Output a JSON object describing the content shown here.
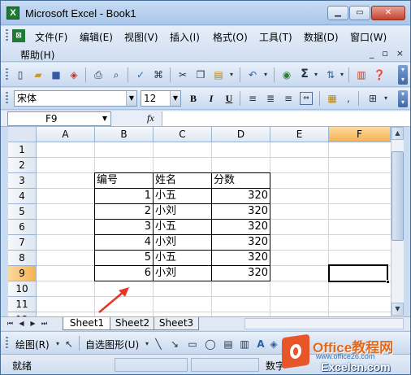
{
  "window": {
    "title": "Microsoft Excel - Book1",
    "app_icon": "X",
    "min": "▁",
    "restore": "▭",
    "close": "✕"
  },
  "menu": {
    "items": [
      "文件(F)",
      "编辑(E)",
      "视图(V)",
      "插入(I)",
      "格式(O)",
      "工具(T)",
      "数据(D)",
      "窗口(W)",
      "帮助(H)"
    ],
    "doc_buttons": [
      "_",
      "▫",
      "×"
    ]
  },
  "toolbar": {
    "font": "宋体",
    "size": "12",
    "bold": "B",
    "italic": "I",
    "underline": "U",
    "sigma": "Σ"
  },
  "formula_bar": {
    "name_box": "F9",
    "fx": "fx",
    "formula": ""
  },
  "sheet": {
    "columns": [
      "A",
      "B",
      "C",
      "D",
      "E",
      "F"
    ],
    "active_column": "F",
    "rows": [
      "1",
      "2",
      "3",
      "4",
      "5",
      "6",
      "7",
      "8",
      "9",
      "10",
      "11",
      "12"
    ],
    "active_row": "9",
    "headers": {
      "b3": "编号",
      "c3": "姓名",
      "d3": "分数"
    },
    "records": [
      {
        "id": "1",
        "name": "小五",
        "score": "320"
      },
      {
        "id": "2",
        "name": "小刘",
        "score": "320"
      },
      {
        "id": "3",
        "name": "小五",
        "score": "320"
      },
      {
        "id": "4",
        "name": "小刘",
        "score": "320"
      },
      {
        "id": "5",
        "name": "小五",
        "score": "320"
      },
      {
        "id": "6",
        "name": "小刘",
        "score": "320"
      }
    ]
  },
  "tabs": {
    "sheets": [
      "Sheet1",
      "Sheet2",
      "Sheet3"
    ],
    "active": "Sheet1"
  },
  "drawing": {
    "draw": "绘图(R)",
    "autoshapes": "自选图形(U)"
  },
  "status": {
    "ready": "就绪",
    "num": "数字"
  },
  "watermark": {
    "brand": "Office教程网",
    "url": "www.office26.com",
    "site": "Excelcn.com"
  },
  "colors": {
    "accent": "#f6b254",
    "arrow": "#e8352a",
    "title_bar": "#c7dcf5"
  }
}
